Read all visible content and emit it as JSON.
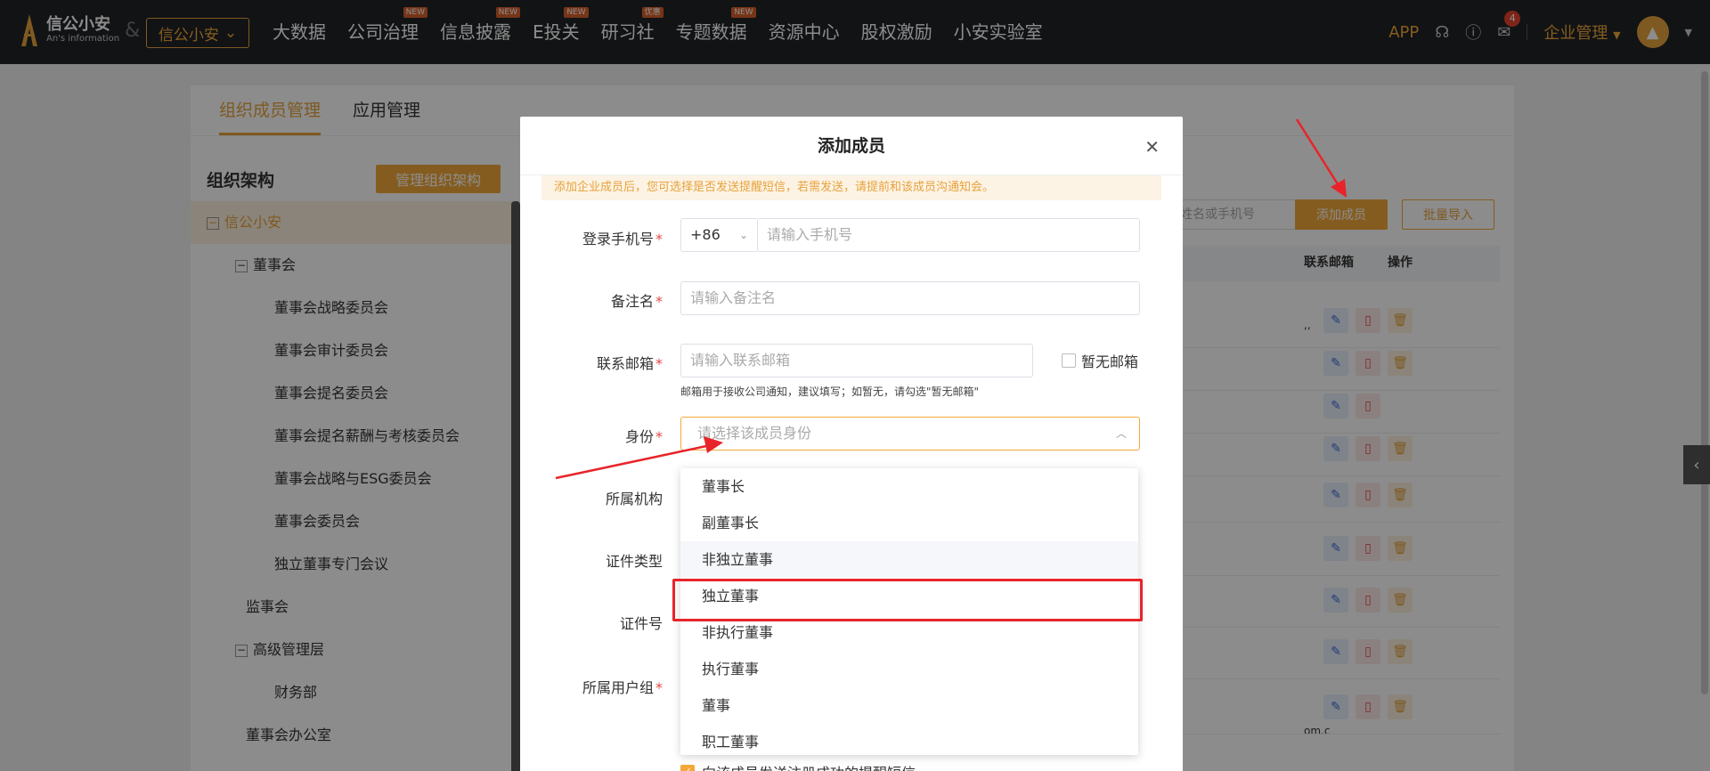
{
  "header": {
    "logo_name": "信公小安",
    "logo_sub": "An's information",
    "amp": "&",
    "tenant": "信公小安",
    "nav": [
      {
        "label": "大数据",
        "badge": ""
      },
      {
        "label": "公司治理",
        "badge": "NEW"
      },
      {
        "label": "信息披露",
        "badge": "NEW"
      },
      {
        "label": "E投关",
        "badge": "NEW"
      },
      {
        "label": "研习社",
        "badge": "优惠"
      },
      {
        "label": "专题数据",
        "badge": "NEW"
      },
      {
        "label": "资源中心",
        "badge": ""
      },
      {
        "label": "股权激励",
        "badge": ""
      },
      {
        "label": "小安实验室",
        "badge": ""
      }
    ],
    "app": "APP",
    "bell_count": "4",
    "enterprise": "企业管理"
  },
  "page": {
    "tabs": [
      "组织成员管理",
      "应用管理"
    ],
    "org_title": "组织架构",
    "org_btn": "管理组织架构",
    "tree": [
      {
        "label": "信公小安",
        "indent": 0,
        "box": "−"
      },
      {
        "label": "董事会",
        "indent": 1,
        "box": "−"
      },
      {
        "label": "董事会战略委员会",
        "indent": 2,
        "box": ""
      },
      {
        "label": "董事会审计委员会",
        "indent": 2,
        "box": ""
      },
      {
        "label": "董事会提名委员会",
        "indent": 2,
        "box": ""
      },
      {
        "label": "董事会提名薪酬与考核委员会",
        "indent": 2,
        "box": ""
      },
      {
        "label": "董事会战略与ESG委员会",
        "indent": 2,
        "box": ""
      },
      {
        "label": "董事会委员会",
        "indent": 2,
        "box": ""
      },
      {
        "label": "独立董事专门会议",
        "indent": 2,
        "box": ""
      },
      {
        "label": "监事会",
        "indent": 1,
        "box": ""
      },
      {
        "label": "高级管理层",
        "indent": 1,
        "box": "−"
      },
      {
        "label": "财务部",
        "indent": 2,
        "box": ""
      },
      {
        "label": "董事会办公室",
        "indent": 1,
        "box": ""
      }
    ],
    "search_placeholder": "姓名或手机号",
    "add_btn": "添加成员",
    "import_btn": "批量导入",
    "col_email": "联系邮箱",
    "col_action": "操作",
    "email_tail_1": ",,",
    "email_tail_2": "om.c"
  },
  "modal": {
    "title": "添加成员",
    "notice": "添加企业成员后，您可选择是否发送提醒短信，若需发送，请提前和该成员沟通知会。",
    "phone_label": "登录手机号",
    "phone_prefix": "+86",
    "phone_placeholder": "请输入手机号",
    "remark_label": "备注名",
    "remark_placeholder": "请输入备注名",
    "email_label": "联系邮箱",
    "email_placeholder": "请输入联系邮箱",
    "no_email": "暂无邮箱",
    "email_hint": "邮箱用于接收公司通知，建议填写；如暂无，请勾选\"暂无邮箱\"",
    "identity_label": "身份",
    "identity_placeholder": "请选择该成员身份",
    "org_label": "所属机构",
    "cert_type_label": "证件类型",
    "cert_no_label": "证件号",
    "group_label": "所属用户组",
    "send_sms": "向该成员发送注册成功的提醒短信"
  },
  "dropdown": {
    "options": [
      "董事长",
      "副董事长",
      "非独立董事",
      "独立董事",
      "非执行董事",
      "执行董事",
      "董事",
      "职工董事"
    ],
    "hovered": "非独立董事",
    "highlighted": "独立董事"
  },
  "colors": {
    "accent": "#f3a83a",
    "highlight_box": "#e8242a"
  }
}
